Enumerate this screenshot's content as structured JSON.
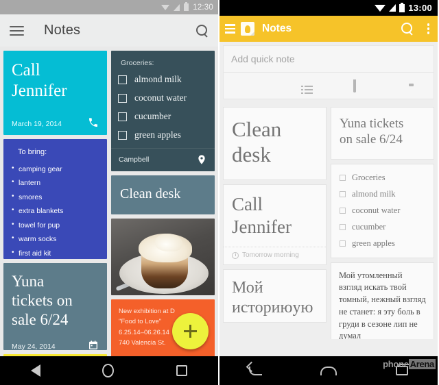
{
  "left_phone": {
    "statusbar": {
      "time": "12:30",
      "icons": [
        "dropdown-triangle-icon",
        "signal-icon",
        "battery-icon"
      ]
    },
    "appbar": {
      "menu_icon": "hamburger-icon",
      "title": "Notes",
      "search_icon": "search-icon"
    },
    "notes": {
      "call": {
        "title": "Call\nJennifer",
        "title_line1": "Call",
        "title_line2": "Jennifer",
        "date": "March 19, 2014",
        "icon": "phone-icon",
        "color": "#05bdd4"
      },
      "bring": {
        "heading": "To bring:",
        "items": [
          "camping gear",
          "lantern",
          "smores",
          "extra blankets",
          "towel for pup",
          "warm socks",
          "first aid kit"
        ],
        "color": "#3a49b7"
      },
      "yuna": {
        "title_line1": "Yuna",
        "title_line2": "tickets on",
        "title_line3": "sale 6/24",
        "date": "May 24, 2014",
        "icon": "calendar-icon",
        "color": "#5d7c8a"
      },
      "yellow_partial": {
        "color": "#f8e831"
      },
      "groceries": {
        "heading": "Groceries:",
        "items": [
          "almond milk",
          "coconut water",
          "cucumber",
          "green apples"
        ],
        "location": "Campbell",
        "icon": "map-pin-icon",
        "color": "#37505a"
      },
      "clean": {
        "title": "Clean desk",
        "color": "#5d7c8a"
      },
      "photo": {
        "alt": "dessert-photo"
      },
      "orange": {
        "line1": "New exhibition at D",
        "line2": "\"Food to Love\"",
        "line3": "6.25.14–06.26.14",
        "line4": "740 Valencia St.",
        "color": "#f4602a"
      }
    },
    "fab": {
      "icon": "plus-icon",
      "color": "#edf23c"
    },
    "navbar": [
      "back-triangle-icon",
      "home-circle-icon",
      "recents-square-icon"
    ]
  },
  "right_phone": {
    "statusbar": {
      "time": "13:00",
      "icons": [
        "wifi-icon",
        "signal-icon",
        "battery-icon"
      ]
    },
    "appbar": {
      "menu_icon": "hamburger-icon",
      "app_icon": "keep-bulb-icon",
      "title": "Notes",
      "search_icon": "search-icon",
      "overflow_icon": "overflow-menu-icon",
      "color": "#f6c329"
    },
    "quicknote": {
      "placeholder": "Add quick note",
      "actions": [
        "note-icon",
        "list-icon",
        "microphone-icon",
        "camera-icon"
      ]
    },
    "notes": {
      "clean": {
        "title_line1": "Clean",
        "title_line2": "desk"
      },
      "call": {
        "title_line1": "Call",
        "title_line2": "Jennifer",
        "reminder": "Tomorrow morning",
        "reminder_icon": "clock-icon"
      },
      "moy": {
        "title_line1": "Мой",
        "title_line2": "историюую"
      },
      "yuna": {
        "title_line1": "Yuna tickets",
        "title_line2": "on sale 6/24"
      },
      "groceries": {
        "items": [
          "Groceries",
          "almond milk",
          "coconut water",
          "cucumber",
          "green apples"
        ]
      },
      "poem": {
        "text": "Мой утомленный взгляд искать твой томный, нежный взгляд не станет: я эту боль в груди в сезоне лип не думал"
      }
    },
    "navbar": [
      "back-arrow-icon",
      "home-icon",
      "recents-icon"
    ],
    "watermark": {
      "part1": "phone",
      "part2": "Arena"
    }
  }
}
